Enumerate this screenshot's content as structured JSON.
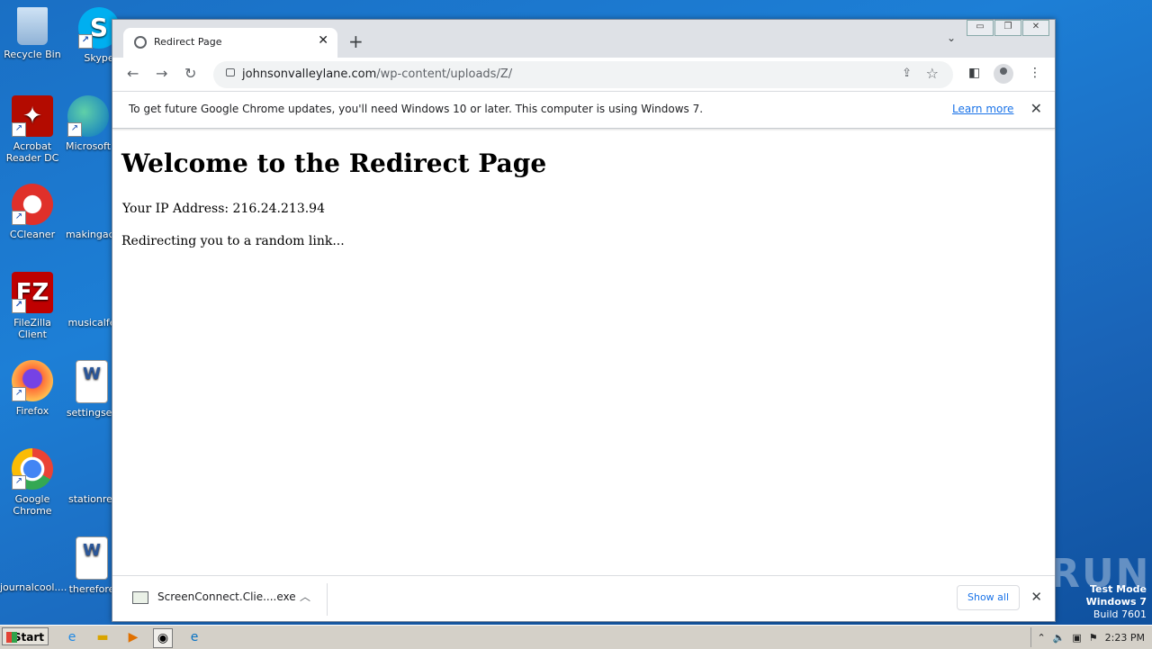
{
  "desktop": {
    "icons": [
      {
        "label": "Recycle Bin"
      },
      {
        "label": "Skype"
      },
      {
        "label": "Acrobat Reader DC"
      },
      {
        "label": "Microsoft"
      },
      {
        "label": "CCleaner"
      },
      {
        "label": "makingact"
      },
      {
        "label": "FileZilla Client"
      },
      {
        "label": "musicalfe"
      },
      {
        "label": "Firefox"
      },
      {
        "label": "settingses"
      },
      {
        "label": "Google Chrome"
      },
      {
        "label": "stationrel"
      },
      {
        "label": "journalcool...."
      },
      {
        "label": "therefore"
      }
    ]
  },
  "browser": {
    "tab": {
      "title": "Redirect Page"
    },
    "address": {
      "host": "johnsonvalleylane.com",
      "path": "/wp-content/uploads/Z/"
    },
    "infobar": {
      "message": "To get future Google Chrome updates, you'll need Windows 10 or later. This computer is using Windows 7.",
      "link": "Learn more"
    },
    "page": {
      "heading": "Welcome to the Redirect Page",
      "ip_line": "Your IP Address: 216.24.213.94",
      "redirect_line": "Redirecting you to a random link..."
    },
    "download": {
      "filename": "ScreenConnect.Clie....exe",
      "show_all": "Show all"
    }
  },
  "watermark": {
    "text": "ANY RUN"
  },
  "test_mode": {
    "line1": "Test Mode",
    "line2": "Windows 7",
    "line3": "Build 7601"
  },
  "taskbar": {
    "start_label": "Start",
    "clock": "2:23 PM"
  }
}
